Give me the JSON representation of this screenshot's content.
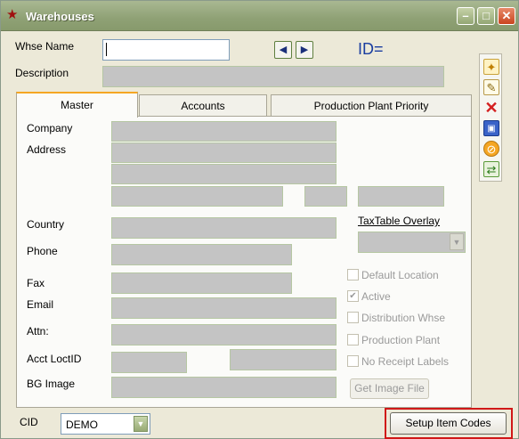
{
  "window": {
    "title": "Warehouses"
  },
  "header": {
    "whse_name_label": "Whse Name",
    "whse_name_value": "",
    "description_label": "Description",
    "id_label": "ID="
  },
  "tabs": [
    {
      "label": "Master",
      "active": true
    },
    {
      "label": "Accounts",
      "active": false
    },
    {
      "label": "Production Plant Priority",
      "active": false
    }
  ],
  "master": {
    "company_label": "Company",
    "address_label": "Address",
    "country_label": "Country",
    "phone_label": "Phone",
    "fax_label": "Fax",
    "email_label": "Email",
    "attn_label": "Attn:",
    "acct_loct_label": "Acct LoctID",
    "bg_image_label": "BG Image",
    "tax_overlay_label": "TaxTable Overlay",
    "get_image_button": "Get Image File",
    "checkboxes": [
      {
        "label": "Default Location",
        "checked": false
      },
      {
        "label": "Active",
        "checked": true
      },
      {
        "label": "Distribution Whse",
        "checked": false
      },
      {
        "label": "Production Plant",
        "checked": false
      },
      {
        "label": "No Receipt Labels",
        "checked": false
      }
    ]
  },
  "footer": {
    "cid_label": "CID",
    "cid_value": "DEMO",
    "setup_button": "Setup Item Codes"
  },
  "side_toolbar": [
    "new-icon",
    "edit-icon",
    "delete-icon",
    "save-icon",
    "cancel-icon",
    "refresh-icon"
  ],
  "colors": {
    "highlight": "#d01818",
    "id_text": "#1a3ea0",
    "tab_accent": "#f5a623"
  }
}
